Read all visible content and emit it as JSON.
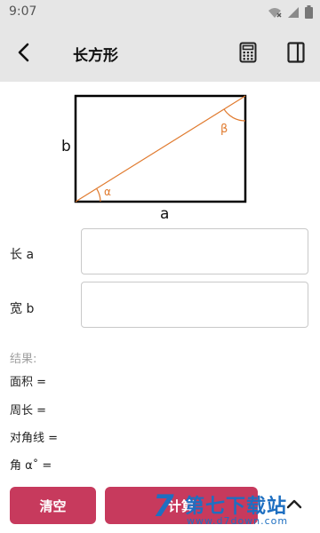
{
  "status_bar": {
    "time": "9:07"
  },
  "app_bar": {
    "title": "长方形"
  },
  "diagram": {
    "label_b": "b",
    "label_a": "a",
    "angle_alpha": "α",
    "angle_beta": "β",
    "line_color": "#e07a2e"
  },
  "fields": {
    "length_label": "长 a",
    "width_label": "宽 b",
    "length_value": "",
    "width_value": ""
  },
  "results": {
    "title": "结果:",
    "area": "面积 =",
    "perimeter": "周长 =",
    "diagonal": "对角线 =",
    "angle": "角 α˚ ="
  },
  "buttons": {
    "clear": "清空",
    "calculate": "计算"
  },
  "watermark": {
    "text": "第七下载站",
    "url": "www.d7down.com",
    "logo": "7"
  },
  "colors": {
    "accent": "#c73a5d",
    "watermark": "#1e6fc1"
  },
  "icons": [
    "back-arrow-icon",
    "calculator-icon",
    "side-panel-icon",
    "chevron-up-icon",
    "wifi-icon",
    "signal-icon",
    "battery-icon"
  ]
}
